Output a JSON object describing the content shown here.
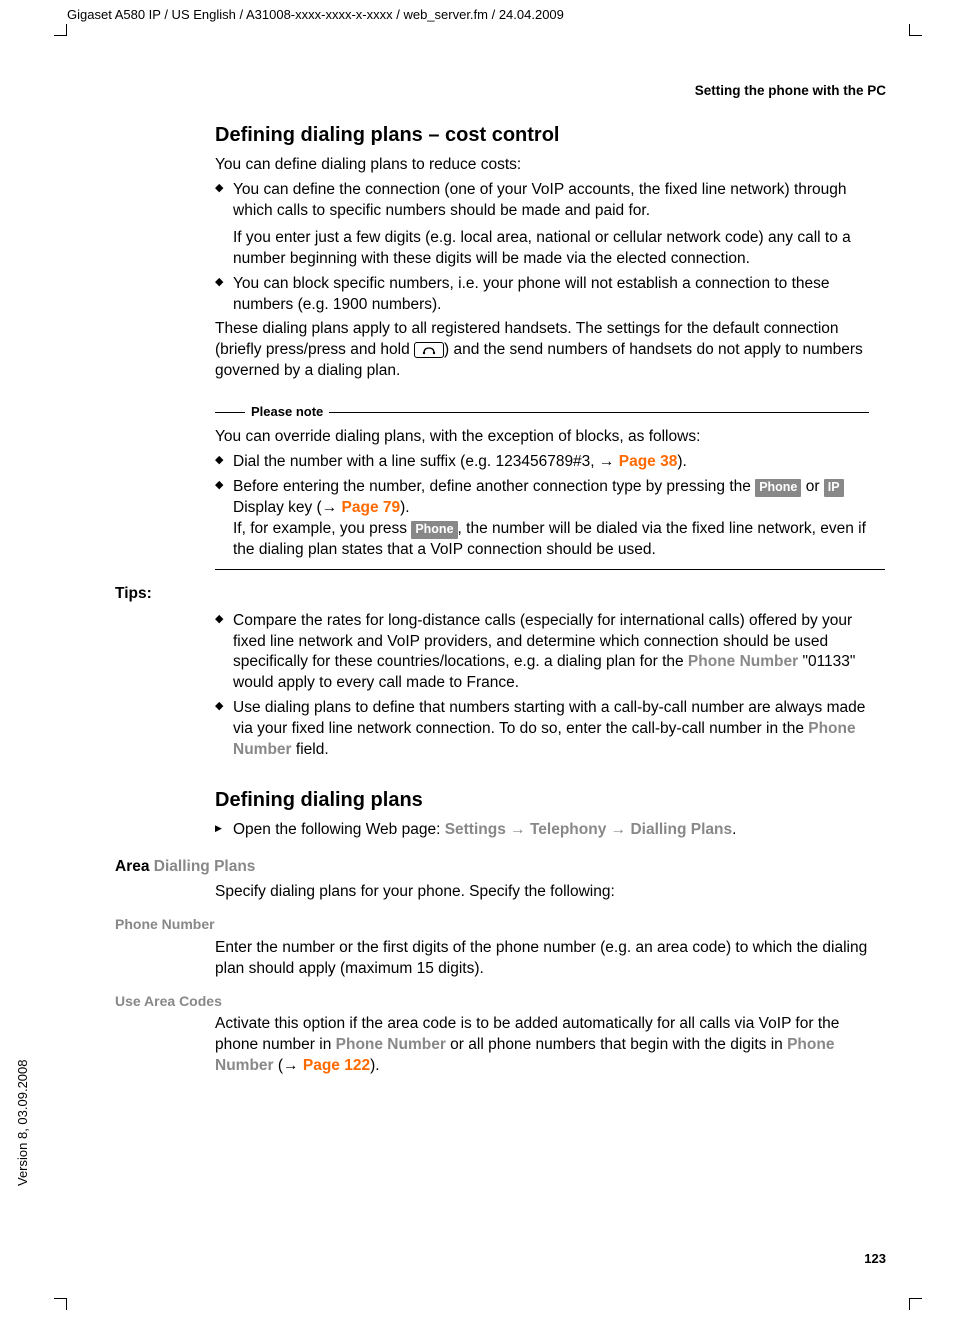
{
  "meta": {
    "headerPath": "Gigaset A580 IP / US English / A31008-xxxx-xxxx-x-xxxx / web_server.fm / 24.04.2009",
    "runningHeader": "Setting the phone with the PC",
    "version": "Version 8, 03.09.2008",
    "pageNumber": "123"
  },
  "section1": {
    "title": "Defining dialing plans – cost control",
    "intro": "You can define dialing plans to reduce costs:",
    "bullet1a": "You can define the connection (one of your VoIP accounts, the fixed line network) through which calls to specific numbers should be made and paid for.",
    "bullet1b": "If you enter just a few digits (e.g. local area, national or cellular network code) any call to a number beginning with these digits will be made via the elected connection.",
    "bullet2": "You can block specific numbers, i.e. your phone will not establish a connection to these numbers (e.g. 1900 numbers).",
    "para2a": "These dialing plans apply to all registered handsets. The settings for the default connection (briefly press/press and hold ",
    "para2b": ") and the send numbers of handsets do not apply to numbers governed by a dialing plan."
  },
  "note": {
    "title": "Please note",
    "intro": "You can override dialing plans, with the exception of blocks, as follows:",
    "b1a": "Dial the number with a line suffix (e.g. 123456789#3,  ",
    "b1link": "Page 38",
    "b1b": ").",
    "b2a": "Before entering the number, define another connection type by pressing the ",
    "b2phone": "Phone",
    "b2or": " or ",
    "b2ip": "IP",
    "b2b": " Display key (",
    "b2link": "Page 79",
    "b2c": ").",
    "b2d": "If, for example, you press ",
    "b2e": ", the number will be dialed via the fixed line network, even if the dialing plan states that a VoIP connection should be used."
  },
  "tips": {
    "label": "Tips:",
    "b1a": "Compare the rates for long-distance calls (especially for international calls) offered by your fixed line network and VoIP providers, and determine which connection should be used specifically for these countries/locations, e.g. a dialing plan for the ",
    "b1term": "Phone Number",
    "b1b": " \"01133\" would apply to every call made to France.",
    "b2a": "Use dialing plans to define that numbers starting with a call-by-call number are always made via your fixed line network connection. To do so, enter the call-by-call number in the ",
    "b2term": "Phone Number",
    "b2b": " field."
  },
  "section2": {
    "title": "Defining dialing plans",
    "step1a": "Open the following Web page: ",
    "stepSettings": "Settings",
    "stepTelephony": "Telephony",
    "stepDialling": "Dialling Plans",
    "period": "."
  },
  "area": {
    "label": "Area ",
    "labelGrey": "Dialling Plans",
    "intro": "Specify dialing plans for your phone. Specify the following:",
    "phoneNumberLabel": "Phone Number",
    "phoneNumberText": "Enter the number or the first digits of the phone number (e.g. an area code) to which the dialing plan should apply (maximum 15 digits).",
    "useAreaCodesLabel": "Use Area Codes",
    "uac1": "Activate this option if the area code is to be added automatically for all calls via VoIP for the phone number in ",
    "uacTerm1": "Phone Number",
    "uac2": " or all phone numbers that begin with the digits in ",
    "uacTerm2": "Phone Number",
    "uac3": " (",
    "uacLink": "Page 122",
    "uac4": ")."
  }
}
